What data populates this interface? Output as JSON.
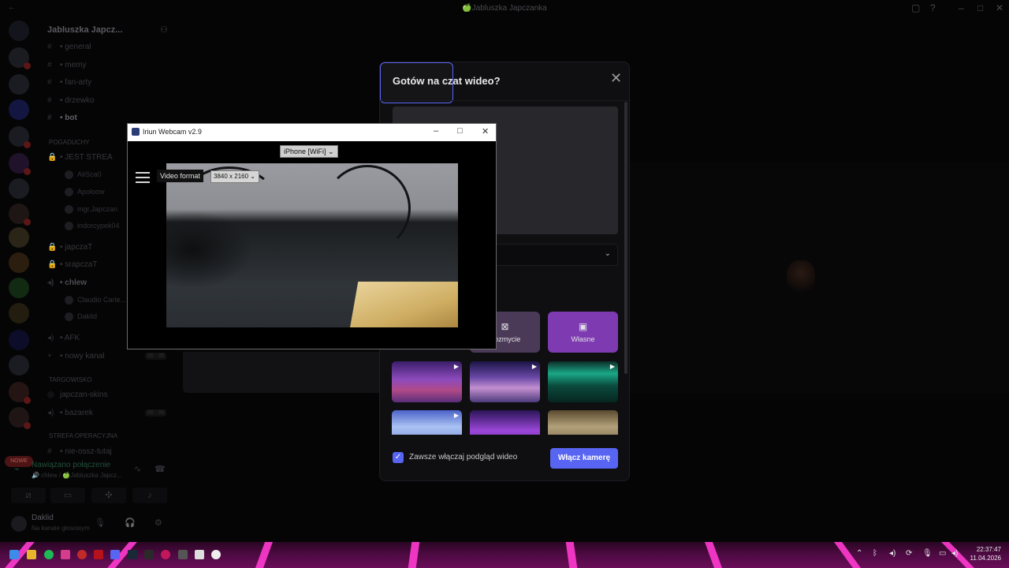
{
  "window": {
    "title": "🍏Jabluszka Japczanka"
  },
  "servers": {
    "new_badge": "NOWE",
    "badge_counts": [
      "29",
      "4",
      "1",
      "3",
      "1",
      "1"
    ]
  },
  "channels": {
    "guild_name": "Jabluszka Japcz...",
    "items": [
      {
        "label": "• general"
      },
      {
        "label": "• memy"
      },
      {
        "label": "• fan-arty"
      },
      {
        "label": "• drzewko"
      },
      {
        "label": "• bot"
      }
    ],
    "cat_pogaduchy": "POGADUCHY",
    "voice_jest_strea": "• JEST STREA",
    "users_1": [
      "AliSca0",
      "Apoloow",
      "mgr.Japczan",
      "indorcypek04"
    ],
    "voice_japczaT": "• japczaT",
    "voice_srapczaT": "• srapczaT",
    "voice_chlew": "• chlew",
    "users_2": [
      "Claudio Carle...",
      "Daklid"
    ],
    "voice_afk": "• AFK",
    "voice_nowy": "• nowy kanał",
    "time_a": "00 : 05",
    "cat_targowisko": "TARGOWISKO",
    "ch_japczan_skins": "japczan-skins",
    "ch_bazarek": "• bazarek",
    "time_b": "00 : 06",
    "cat_strefa": "STREFA OPERACYJNA",
    "ch_nie_ossz": "• nie-ossz-tutaj"
  },
  "voice": {
    "status": "Nawiązano połączenie",
    "channel": "🔊 chlew / 🍏Jabluszka Japcz..."
  },
  "user": {
    "name": "Daklid",
    "status": "Na kanale głosowym"
  },
  "modal": {
    "title": "Gotów na czat wideo?",
    "bg_blur_label": "Rozmycie",
    "bg_custom_label": "Własne",
    "always_preview_label": "Zawsze włączaj podgląd wideo",
    "enable_camera_label": "Włącz kamerę"
  },
  "iriun": {
    "title": "Iriun Webcam v2.9",
    "source": "iPhone [WiFi]",
    "format_label": "Video format",
    "format_value": "3840 x 2160"
  },
  "taskbar": {
    "time": "22:37:47",
    "date": "11.04.2026"
  },
  "colors": {
    "accent": "#5865f2",
    "custom_bg": "#7e3ab0",
    "taskbar": "#6a0d59"
  }
}
